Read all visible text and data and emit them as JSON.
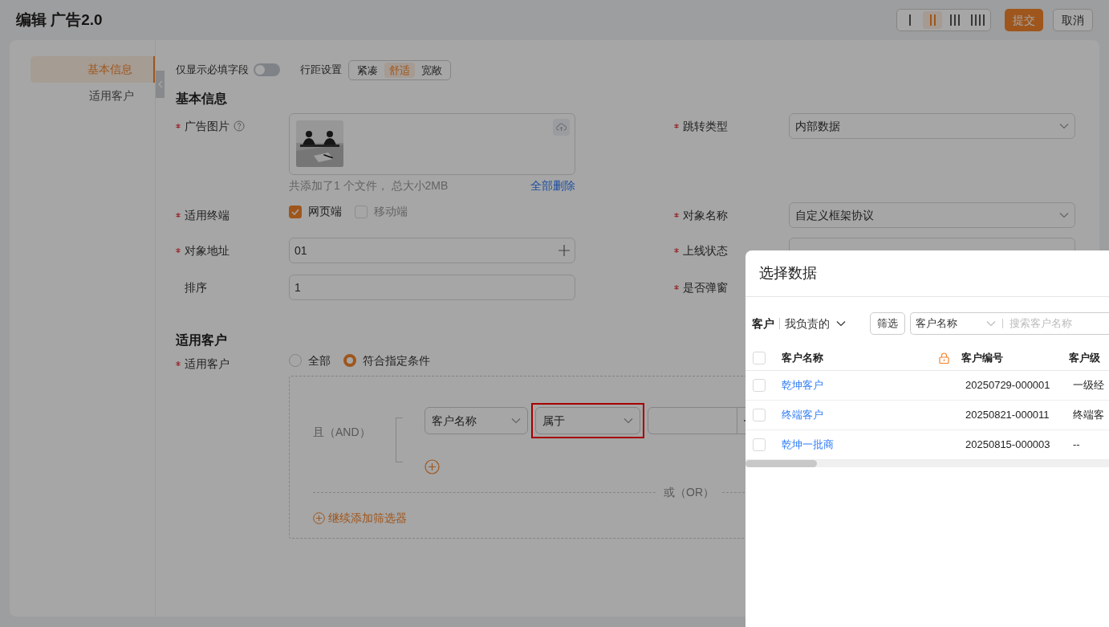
{
  "header": {
    "title": "编辑 广告2.0",
    "density_options": [
      {
        "selected": false
      },
      {
        "selected": true
      },
      {
        "selected": false
      },
      {
        "selected": false
      }
    ],
    "submit": "提交",
    "cancel": "取消"
  },
  "nav": {
    "items": [
      {
        "label": "基本信息",
        "selected": true
      },
      {
        "label": "适用客户",
        "selected": false
      }
    ]
  },
  "toolbar": {
    "required_only": {
      "label": "仅显示必填字段",
      "on": false
    },
    "spacing": {
      "label": "行距设置",
      "options": [
        {
          "label": "紧凑",
          "selected": false
        },
        {
          "label": "舒适",
          "selected": true
        },
        {
          "label": "宽敞",
          "selected": false
        }
      ]
    }
  },
  "basic_section": {
    "title": "基本信息",
    "image": {
      "label": "广告图片",
      "required": true,
      "caption": "共添加了1 个文件， 总大小2MB",
      "delete_all": "全部删除"
    },
    "terminal": {
      "label": "适用终端",
      "required": true,
      "options": [
        {
          "label": "网页端",
          "checked": true
        },
        {
          "label": "移动端",
          "checked": false
        }
      ]
    },
    "address": {
      "label": "对象地址",
      "required": true,
      "value": "01"
    },
    "sort": {
      "label": "排序",
      "required": false,
      "value": "1"
    },
    "jump_type": {
      "label": "跳转类型",
      "required": true,
      "value": "内部数据"
    },
    "object_name": {
      "label": "对象名称",
      "required": true,
      "value": "自定义框架协议"
    },
    "online_status": {
      "label": "上线状态",
      "required": true
    },
    "popup": {
      "label": "是否弹窗",
      "required": true
    }
  },
  "customer_section": {
    "title": "适用客户",
    "field_label": "适用客户",
    "required": true,
    "radios": [
      {
        "label": "全部",
        "selected": false
      },
      {
        "label": "符合指定条件",
        "selected": true
      }
    ],
    "and_label": "且（AND）",
    "condition": {
      "field": "客户名称",
      "operator": "属于",
      "highlighted": true
    },
    "or_label": "或（OR）",
    "add_filter": "继续添加筛选器"
  },
  "drawer": {
    "title": "选择数据",
    "scope": "客户",
    "owner": "我负责的",
    "filter_button": "筛选",
    "search_field": "客户名称",
    "search_placeholder": "搜索客户名称",
    "columns": [
      "客户名称",
      "客户编号",
      "客户级"
    ],
    "header_checked": false,
    "rows": [
      {
        "name": "乾坤客户",
        "code": "20250729-000001",
        "level": "一级经",
        "checked": false
      },
      {
        "name": "终端客户",
        "code": "20250821-000011",
        "level": "终端客",
        "checked": false
      },
      {
        "name": "乾坤一批商",
        "code": "20250815-000003",
        "level": "--",
        "checked": false
      }
    ]
  }
}
